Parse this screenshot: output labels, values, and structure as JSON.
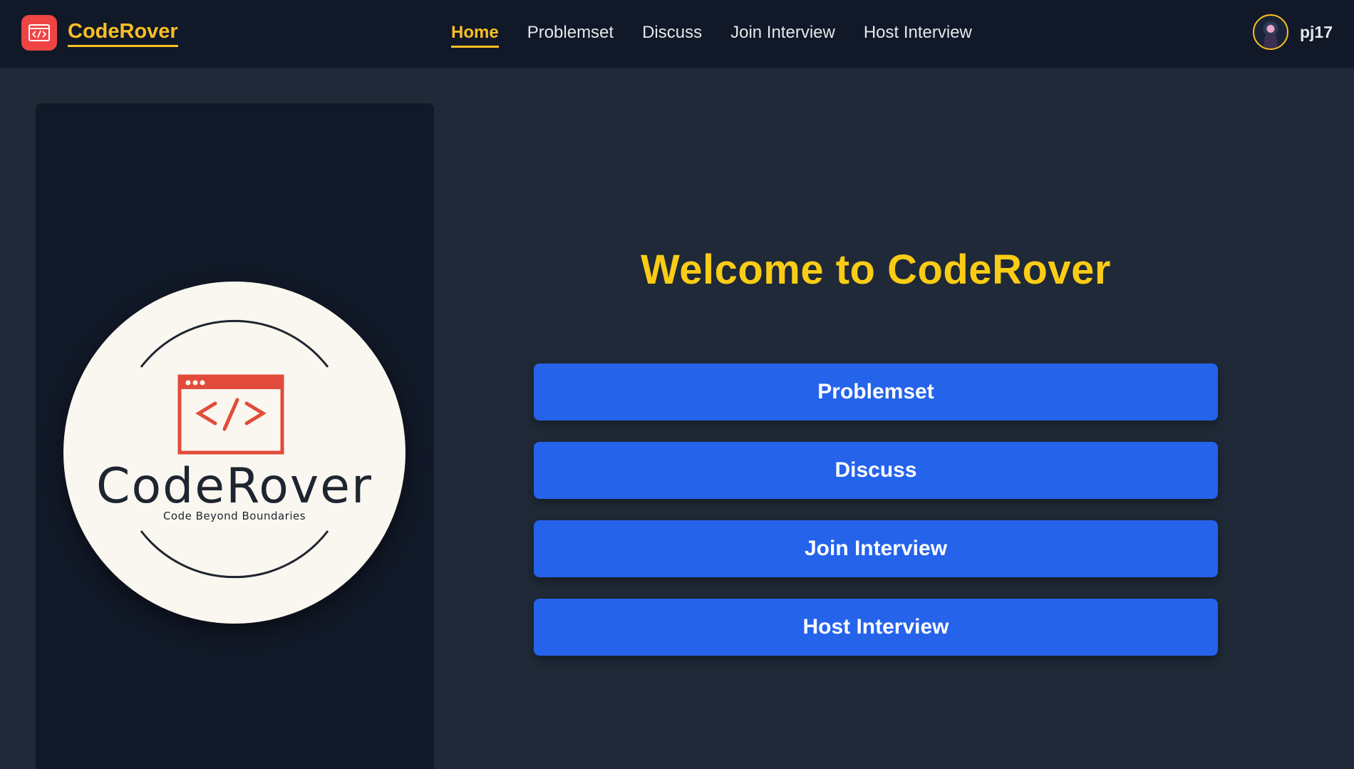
{
  "brand": {
    "name": "CodeRover",
    "icon": "code-window-icon"
  },
  "nav": {
    "items": [
      {
        "label": "Home",
        "active": true
      },
      {
        "label": "Problemset",
        "active": false
      },
      {
        "label": "Discuss",
        "active": false
      },
      {
        "label": "Join Interview",
        "active": false
      },
      {
        "label": "Host Interview",
        "active": false
      }
    ]
  },
  "user": {
    "username": "pj17",
    "avatar": "user-avatar"
  },
  "logo": {
    "wordmark": "CodeRover",
    "tagline": "Code Beyond Boundaries",
    "symbol": "</>"
  },
  "main": {
    "heading": "Welcome to CodeRover",
    "buttons": [
      {
        "label": "Problemset"
      },
      {
        "label": "Discuss"
      },
      {
        "label": "Join Interview"
      },
      {
        "label": "Host Interview"
      }
    ]
  },
  "colors": {
    "page_bg": "#1f2937",
    "navbar_bg": "#111827",
    "accent_yellow": "#facc15",
    "brand_red": "#ef4444",
    "button_blue": "#2563eb"
  }
}
